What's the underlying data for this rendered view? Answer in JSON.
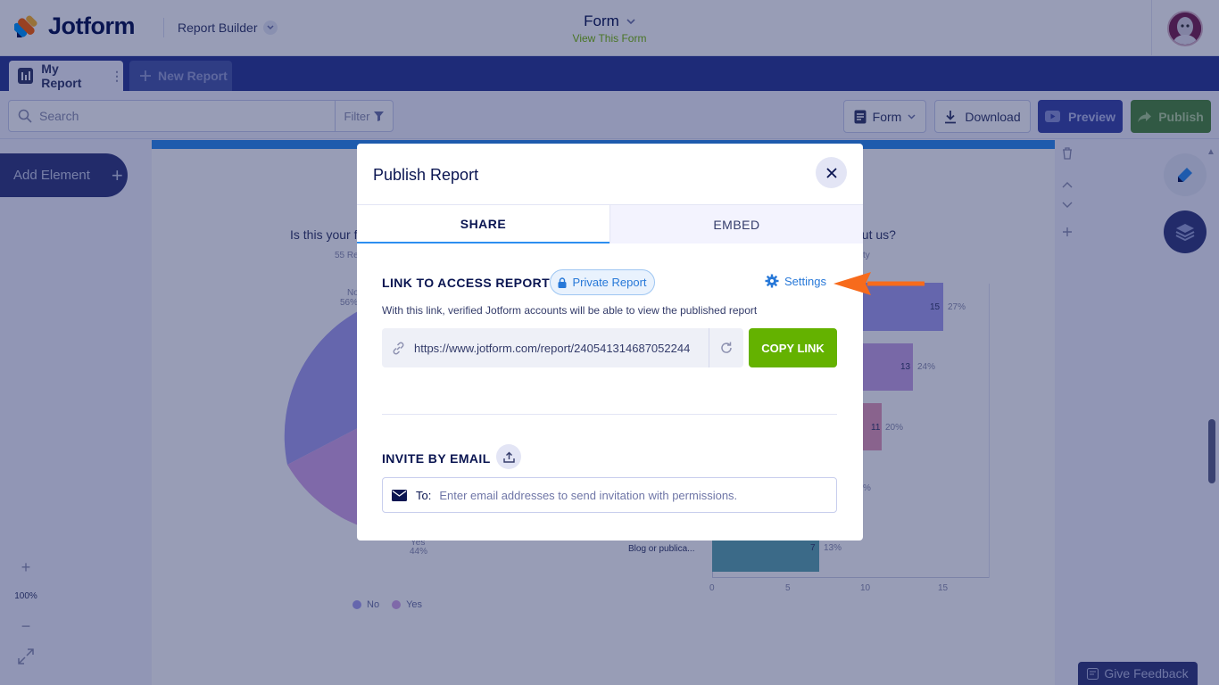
{
  "header": {
    "brand": "Jotform",
    "builder_label": "Report Builder",
    "form_title": "Form",
    "form_subtitle": "View This Form"
  },
  "tabs": {
    "my_report": "My Report",
    "new_report": "New Report"
  },
  "toolbar": {
    "search_placeholder": "Search",
    "filter_label": "Filter",
    "form_label": "Form",
    "download_label": "Download",
    "preview_label": "Preview",
    "publish_label": "Publish"
  },
  "workspace": {
    "add_element_label": "Add Element",
    "chart1_title": "Is this your f",
    "chart1_responses": "55 Re",
    "chart2_title": "out us?",
    "chart2_sub": "ty",
    "pie_label_no": "No",
    "pie_pct_no": "56%",
    "pie_label_yes": "Yes",
    "pie_pct_yes": "44%",
    "legend_no": "No",
    "legend_yes": "Yes",
    "bar_rows": [
      {
        "value": "15",
        "pct": "27%"
      },
      {
        "value": "13",
        "pct": "24%"
      },
      {
        "value": "11",
        "pct": "20%"
      },
      {
        "value": "",
        "pct": "%"
      },
      {
        "label": "Blog or publica...",
        "value": "7",
        "pct": "13%"
      }
    ],
    "x_ticks": [
      "0",
      "5",
      "10",
      "15"
    ],
    "zoom_level": "100%",
    "feedback_label": "Give Feedback"
  },
  "modal": {
    "title": "Publish Report",
    "tab_share": "SHARE",
    "tab_embed": "EMBED",
    "link_section_title": "LINK TO ACCESS REPORT",
    "private_badge": "Private Report",
    "settings_label": "Settings",
    "description": "With this link, verified Jotform accounts will be able to view the published report",
    "link_url": "https://www.jotform.com/report/240541314687052244",
    "copy_link_label": "COPY LINK",
    "invite_section_title": "INVITE BY EMAIL",
    "email_to_label": "To:",
    "email_placeholder": "Enter email addresses to send invitation with permissions."
  },
  "colors": {
    "accent_blue": "#2d8ef0",
    "copy_green": "#64b200",
    "annotation_arrow": "#f76b1c",
    "navy": "#0a1551"
  }
}
